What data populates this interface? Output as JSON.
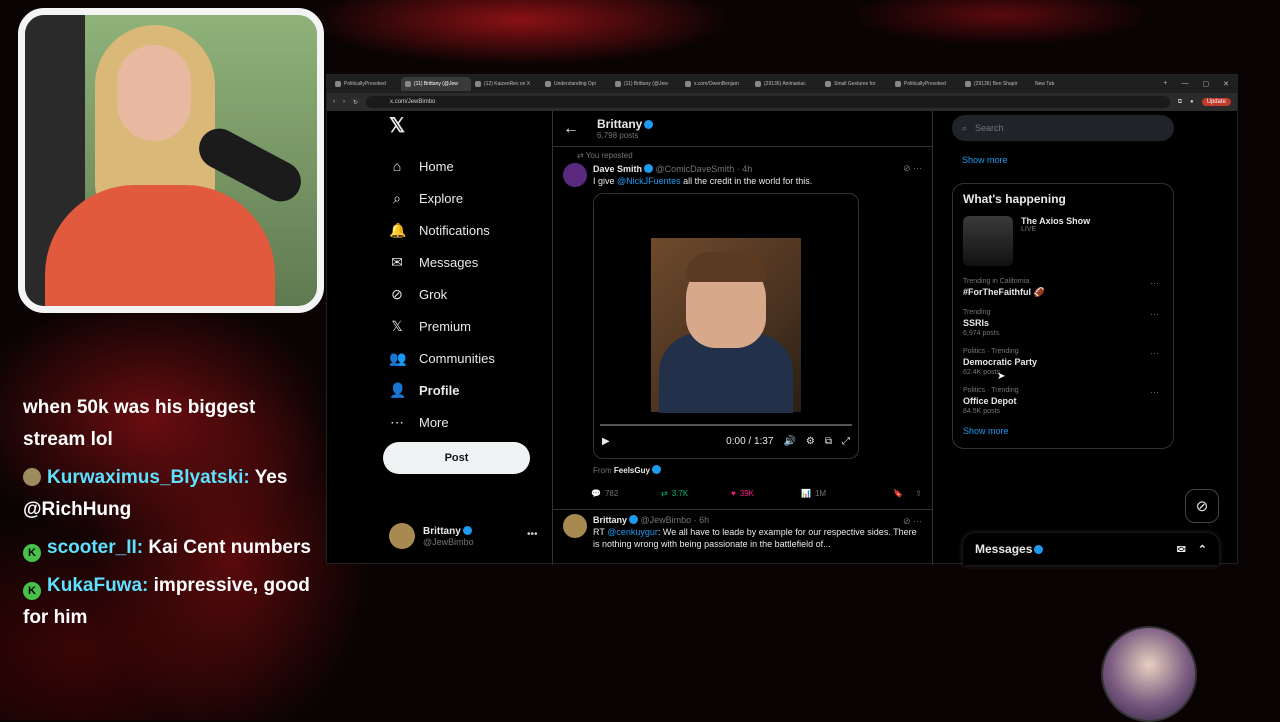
{
  "chat": [
    {
      "user": "",
      "message": "when 50k was his biggest stream lol",
      "badge": ""
    },
    {
      "user": "Kurwaximus_Blyatski:",
      "message": "Yes @RichHung",
      "badge": "img"
    },
    {
      "user": "scooter_II:",
      "message": "Kai Cent numbers",
      "badge": "green"
    },
    {
      "user": "KukaFuwa:",
      "message": "impressive, good for him",
      "badge": "green"
    }
  ],
  "browser": {
    "tabs": [
      "PoliticallyProvoked",
      "(11) Brittany (@Jew",
      "(12) KaizenRev on X",
      "Understanding Opi",
      "(11) Brittany (@Jew",
      "x.com/OwenBenjam",
      "(29136) Animaniac",
      "Small Gestures for",
      "PoliticallyProvoked",
      "(29136) Ben Shapir",
      "New Tab"
    ],
    "url": "x.com/JewBimbo",
    "update_label": "Update",
    "winbtns": [
      "+",
      "—",
      "▢",
      "✕"
    ]
  },
  "nav": {
    "logo": "𝕏",
    "items": [
      {
        "label": "Home",
        "icon": "⌂"
      },
      {
        "label": "Explore",
        "icon": "⌕"
      },
      {
        "label": "Notifications",
        "icon": "🔔"
      },
      {
        "label": "Messages",
        "icon": "✉"
      },
      {
        "label": "Grok",
        "icon": "⊘"
      },
      {
        "label": "Premium",
        "icon": "𝕏"
      },
      {
        "label": "Communities",
        "icon": "👥"
      },
      {
        "label": "Profile",
        "icon": "👤"
      },
      {
        "label": "More",
        "icon": "⋯"
      }
    ],
    "post_label": "Post",
    "profile_name": "Brittany",
    "profile_handle": "@JewBimbo"
  },
  "feed": {
    "title": "Brittany",
    "post_count": "6,798 posts",
    "tweet1": {
      "repost": "You reposted",
      "name": "Dave Smith",
      "handle": "@ComicDaveSmith · 4h",
      "text_pre": "I give ",
      "mention": "@NickJFuentes",
      "text_post": " all the credit in the world for this.",
      "video_time": "0:00 / 1:37",
      "from_label": "From",
      "from_name": "FeelsGuy",
      "replies": "782",
      "reposts": "3.7K",
      "likes": "39K",
      "views": "1M"
    },
    "tweet2": {
      "name": "Brittany",
      "handle": "@JewBimbo · 6h",
      "rt": "RT ",
      "mention": "@cenkuygur",
      "text": ": We all have to leade by example for our respective sides. There is nothing wrong with being passionate in the battlefield of..."
    }
  },
  "sidebar": {
    "search_placeholder": "Search",
    "show_more": "Show more",
    "whats_happening": "What's happening",
    "news_title": "The Axios Show",
    "news_status": "LIVE",
    "trends": [
      {
        "meta": "Trending in California",
        "name": "#ForTheFaithful 🏈",
        "count": ""
      },
      {
        "meta": "Trending",
        "name": "SSRIs",
        "count": "6,974 posts"
      },
      {
        "meta": "Politics · Trending",
        "name": "Democratic Party",
        "count": "62.4K posts"
      },
      {
        "meta": "Politics · Trending",
        "name": "Office Depot",
        "count": "84.5K posts"
      }
    ],
    "show_more_2": "Show more",
    "messages_label": "Messages"
  },
  "colors": {
    "accent": "#1d9bf0",
    "repost": "#00ba7c",
    "like": "#f91880"
  }
}
